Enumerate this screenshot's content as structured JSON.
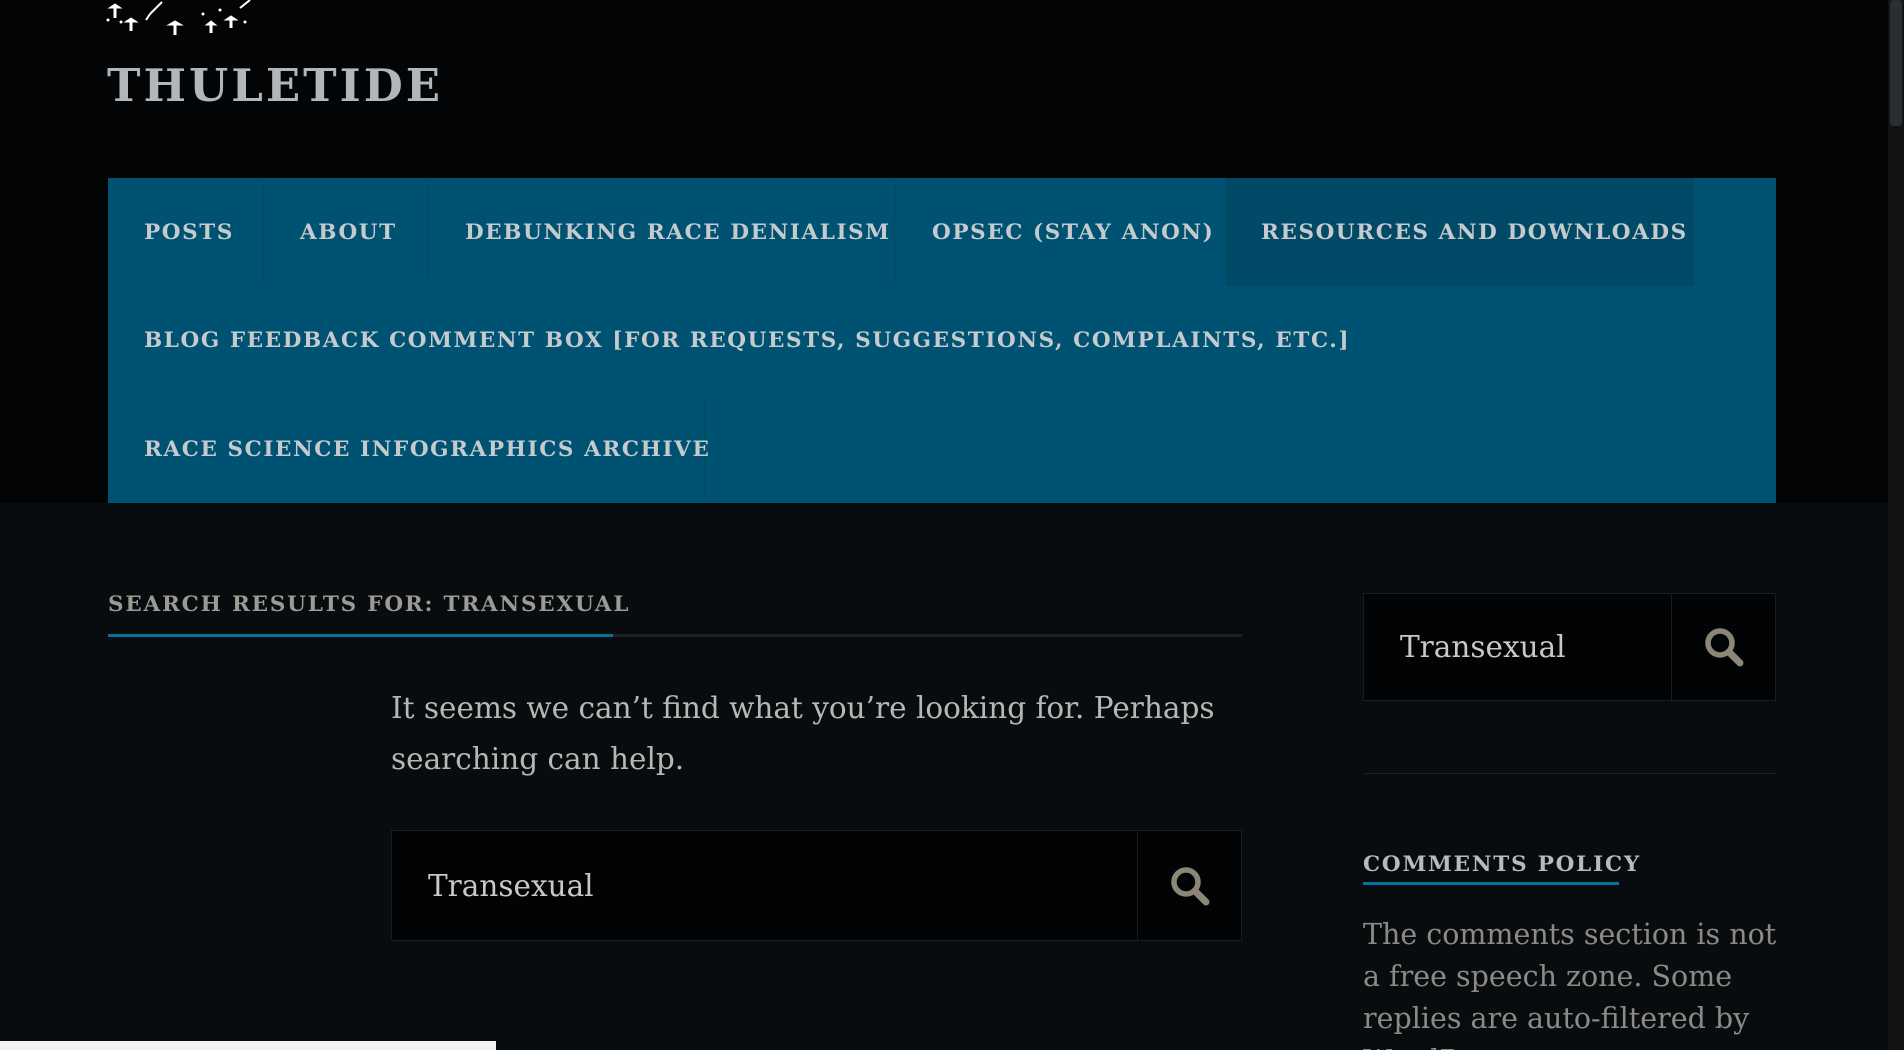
{
  "site": {
    "title": "THULETIDE",
    "logo_icon": "mushroom-silhouettes-logo"
  },
  "nav": {
    "items": [
      {
        "label": "POSTS"
      },
      {
        "label": "ABOUT"
      },
      {
        "label": "DEBUNKING RACE DENIALISM"
      },
      {
        "label": "OPSEC (STAY ANON)"
      },
      {
        "label": "RESOURCES AND DOWNLOADS"
      },
      {
        "label": "BLOG FEEDBACK COMMENT BOX [FOR REQUESTS, SUGGESTIONS, COMPLAINTS, ETC.]"
      },
      {
        "label": "RACE SCIENCE INFOGRAPHICS ARCHIVE"
      }
    ]
  },
  "main": {
    "heading": "SEARCH RESULTS FOR: TRANSEXUAL",
    "message": "It seems we can’t find what you’re looking for. Perhaps searching can help.",
    "search": {
      "value": "Transexual",
      "button_icon": "search-icon"
    }
  },
  "sidebar": {
    "search": {
      "value": "Transexual",
      "button_icon": "search-icon"
    },
    "widget": {
      "title": "COMMENTS POLICY",
      "text": "The comments section is not a free speech zone. Some replies are auto-filtered by WordPress"
    }
  },
  "colors": {
    "nav_background": "#005273",
    "accent": "#0a6f99",
    "page_background": "#090c0e",
    "header_background": "#030405"
  }
}
